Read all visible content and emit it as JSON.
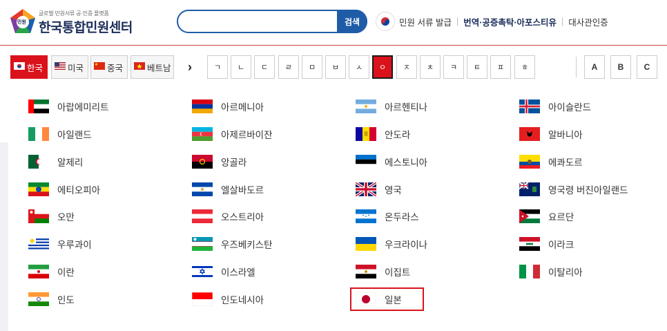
{
  "header": {
    "logo_small": "글로벌 민원서류 공·인증 플랫폼",
    "logo_big": "한국통합민원센터",
    "logo_badge": "민원",
    "search_placeholder": "",
    "search_button": "검색",
    "nav": {
      "item1": "민원 서류 발급",
      "item2": "번역·공증촉탁·아포스티유",
      "item3": "대사관인증"
    }
  },
  "filter": {
    "languages": [
      {
        "label": "한국",
        "icon": "korea-flag-icon"
      },
      {
        "label": "미국",
        "icon": "usa-flag-icon"
      },
      {
        "label": "중국",
        "icon": "china-flag-icon"
      },
      {
        "label": "베트남",
        "icon": "vietnam-flag-icon"
      }
    ],
    "next": "›",
    "hangul": [
      "ㄱ",
      "ㄴ",
      "ㄷ",
      "ㄹ",
      "ㅁ",
      "ㅂ",
      "ㅅ",
      "ㅇ",
      "ㅈ",
      "ㅊ",
      "ㅋ",
      "ㅌ",
      "ㅍ",
      "ㅎ"
    ],
    "latin": [
      "A",
      "B",
      "C"
    ],
    "active_key": "ㅇ"
  },
  "countries": [
    {
      "name": "아랍에미리트",
      "flag": "uae-flag-icon"
    },
    {
      "name": "아르메니아",
      "flag": "armenia-flag-icon"
    },
    {
      "name": "아르헨티나",
      "flag": "argentina-flag-icon"
    },
    {
      "name": "아이슬란드",
      "flag": "iceland-flag-icon"
    },
    {
      "name": "아일랜드",
      "flag": "ireland-flag-icon"
    },
    {
      "name": "아제르바이잔",
      "flag": "azerbaijan-flag-icon"
    },
    {
      "name": "안도라",
      "flag": "andorra-flag-icon"
    },
    {
      "name": "알바니아",
      "flag": "albania-flag-icon"
    },
    {
      "name": "알제리",
      "flag": "algeria-flag-icon"
    },
    {
      "name": "앙골라",
      "flag": "angola-flag-icon"
    },
    {
      "name": "에스토니아",
      "flag": "estonia-flag-icon"
    },
    {
      "name": "에콰도르",
      "flag": "ecuador-flag-icon"
    },
    {
      "name": "에티오피아",
      "flag": "ethiopia-flag-icon"
    },
    {
      "name": "엘살바도르",
      "flag": "el-salvador-flag-icon"
    },
    {
      "name": "영국",
      "flag": "uk-flag-icon"
    },
    {
      "name": "영국령 버진아일랜드",
      "flag": "bvi-flag-icon"
    },
    {
      "name": "오만",
      "flag": "oman-flag-icon"
    },
    {
      "name": "오스트리아",
      "flag": "austria-flag-icon"
    },
    {
      "name": "온두라스",
      "flag": "honduras-flag-icon"
    },
    {
      "name": "요르단",
      "flag": "jordan-flag-icon"
    },
    {
      "name": "우루과이",
      "flag": "uruguay-flag-icon"
    },
    {
      "name": "우즈베키스탄",
      "flag": "uzbekistan-flag-icon"
    },
    {
      "name": "우크라이나",
      "flag": "ukraine-flag-icon"
    },
    {
      "name": "이라크",
      "flag": "iraq-flag-icon"
    },
    {
      "name": "이란",
      "flag": "iran-flag-icon"
    },
    {
      "name": "이스라엘",
      "flag": "israel-flag-icon"
    },
    {
      "name": "이집트",
      "flag": "egypt-flag-icon"
    },
    {
      "name": "이탈리아",
      "flag": "italy-flag-icon"
    },
    {
      "name": "인도",
      "flag": "india-flag-icon"
    },
    {
      "name": "인도네시아",
      "flag": "indonesia-flag-icon"
    },
    {
      "name": "일본",
      "flag": "japan-flag-icon",
      "selected": true
    }
  ],
  "colors": {
    "accent": "#d9121b",
    "brand": "#1c2d5a",
    "search": "#1f5ca8"
  }
}
